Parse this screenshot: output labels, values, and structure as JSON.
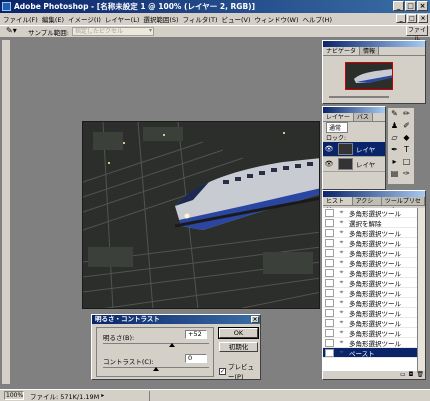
{
  "window": {
    "title": "Adobe Photoshop - [名称未設定 1 @ 100% (レイヤー 2, RGB)]",
    "min": "_",
    "max": "□",
    "close": "×"
  },
  "menubar": {
    "items": [
      "ファイル(F)",
      "編集(E)",
      "イメージ(I)",
      "レイヤー(L)",
      "選択範囲(S)",
      "フィルタ(T)",
      "ビュー(V)",
      "ウィンドウ(W)",
      "ヘルプ(H)"
    ]
  },
  "options": {
    "label": "サンプル範囲:",
    "select": "指定したピクセル"
  },
  "palette_well": {
    "label": "ファイル"
  },
  "navigator": {
    "tabs": [
      "ナビゲータ",
      "情報"
    ]
  },
  "layers": {
    "tabs": [
      "レイヤー",
      "パス"
    ],
    "blend": "通常",
    "lock_label": "ロック:",
    "rows": [
      "レイヤ",
      "レイヤ"
    ],
    "eye": "👁"
  },
  "history": {
    "tabs": [
      "ヒストリー",
      "アクション",
      "ツールプリセット"
    ],
    "rows": [
      "多角形選択ツール",
      "選択を解除",
      "多角形選択ツール",
      "多角形選択ツール",
      "多角形選択ツール",
      "多角形選択ツール",
      "多角形選択ツール",
      "多角形選択ツール",
      "多角形選択ツール",
      "多角形選択ツール",
      "多角形選択ツール",
      "多角形選択ツール",
      "多角形選択ツール",
      "多角形選択ツール",
      "ペースト"
    ],
    "selected_index": 14
  },
  "dialog": {
    "title": "明るさ・コントラスト",
    "brightness_label": "明るさ(B):",
    "brightness_value": "+52",
    "contrast_label": "コントラスト(C):",
    "contrast_value": "0",
    "ok": "OK",
    "reset": "初期化",
    "preview_label": "プレビュー(P)",
    "preview_checked": true,
    "check_mark": "✓",
    "close": "×"
  },
  "status": {
    "zoom": "100%",
    "info": "ファイル: 571K/1.19M",
    "arrow": "▸"
  }
}
